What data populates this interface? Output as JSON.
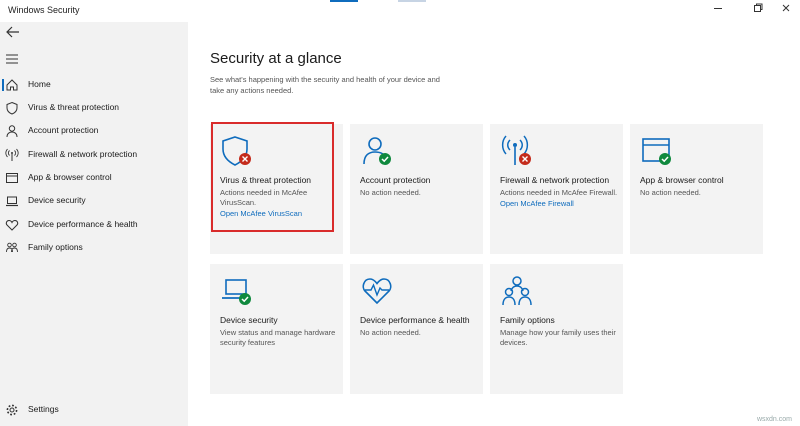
{
  "window": {
    "title": "Windows Security",
    "minimize_icon": "minimize-icon",
    "maximize_icon": "maximize-icon",
    "close_icon": "close-icon"
  },
  "sidebar": {
    "back_icon": "back-arrow-icon",
    "menu_icon": "hamburger-menu-icon",
    "items": [
      {
        "label": "Home",
        "icon": "home-icon",
        "active": true
      },
      {
        "label": "Virus & threat protection",
        "icon": "shield-icon"
      },
      {
        "label": "Account protection",
        "icon": "person-icon"
      },
      {
        "label": "Firewall & network protection",
        "icon": "antenna-icon"
      },
      {
        "label": "App & browser control",
        "icon": "browser-window-icon"
      },
      {
        "label": "Device security",
        "icon": "laptop-icon"
      },
      {
        "label": "Device performance & health",
        "icon": "heart-icon"
      },
      {
        "label": "Family options",
        "icon": "family-icon"
      }
    ],
    "settings": {
      "label": "Settings",
      "icon": "gear-icon"
    }
  },
  "main": {
    "title": "Security at a glance",
    "description": "See what's happening with the security and health of your device and take any actions needed.",
    "tiles": [
      {
        "title": "Virus & threat protection",
        "status": "Actions needed in McAfee VirusScan.",
        "link": "Open McAfee VirusScan",
        "icon": "shield-error-icon",
        "state": "error",
        "highlighted": true
      },
      {
        "title": "Account protection",
        "status": "No action needed.",
        "link": "",
        "icon": "person-ok-icon",
        "state": "ok"
      },
      {
        "title": "Firewall & network protection",
        "status": "Actions needed in McAfee Firewall.",
        "link": "Open McAfee Firewall",
        "icon": "antenna-error-icon",
        "state": "error"
      },
      {
        "title": "App & browser control",
        "status": "No action needed.",
        "link": "",
        "icon": "browser-ok-icon",
        "state": "ok"
      },
      {
        "title": "Device security",
        "status": "View status and manage hardware security features",
        "link": "",
        "icon": "laptop-ok-icon",
        "state": "ok"
      },
      {
        "title": "Device performance & health",
        "status": "No action needed.",
        "link": "",
        "icon": "heart-pulse-icon",
        "state": "none"
      },
      {
        "title": "Family options",
        "status": "Manage how your family uses their devices.",
        "link": "",
        "icon": "family-icon",
        "state": "none"
      }
    ]
  },
  "colors": {
    "accent": "#0f6cbd",
    "ok": "#10893e",
    "error": "#c42b1c",
    "highlight_border": "#d92b2b",
    "tile_bg": "#f3f3f3",
    "sidebar_bg": "#f2f2f2"
  },
  "watermark": "wsxdn.com"
}
